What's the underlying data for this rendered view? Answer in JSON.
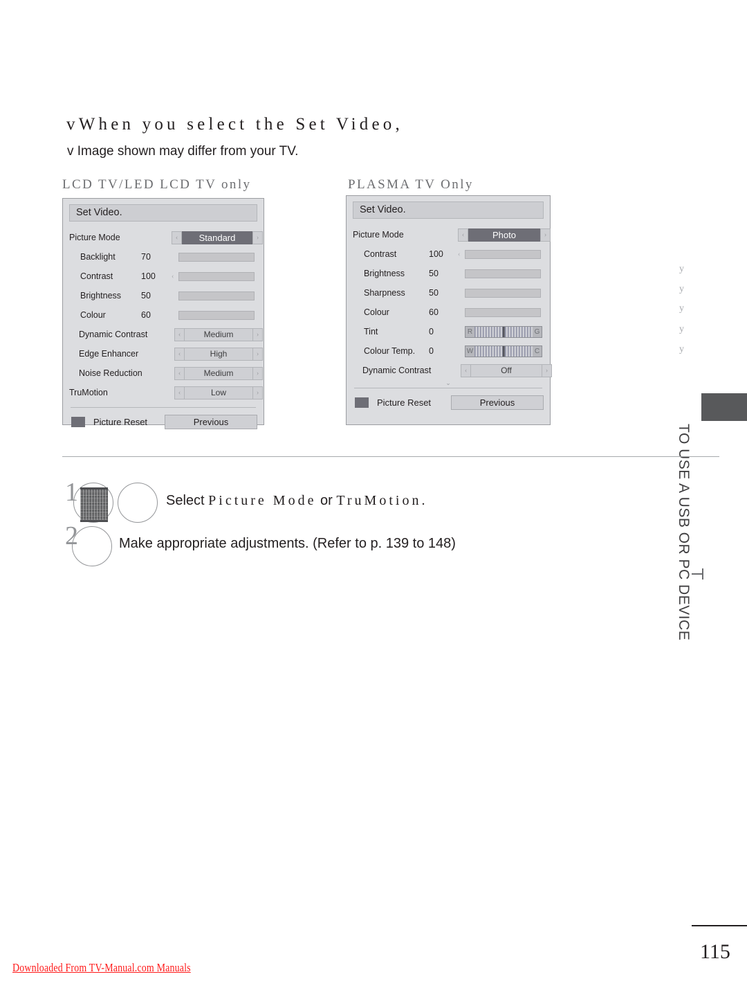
{
  "page": {
    "heading": "vWhen you select the Set Video,",
    "sub_note": "v Image shown may differ from your TV.",
    "page_number": "115",
    "download_link": "Downloaded From TV-Manual.com Manuals",
    "side_tab_text": "TO USE A USB OR PC DEVICE",
    "ghost_marks": [
      "y",
      "y",
      "y",
      "y",
      "y"
    ]
  },
  "captions": {
    "lcd": "LCD TV/LED LCD TV only",
    "plasma": "PLASMA TV Only"
  },
  "colors": {
    "osd_background": "#dcdde0",
    "osd_title_bar": "#cdced2",
    "slider_fill": "#6a6a72",
    "slider_track": "#c5c5c8",
    "highlight": "#6e6e76",
    "side_tab_block": "#58595b",
    "link_red": "#ff1a1a"
  },
  "lcd_panel": {
    "title": "Set Video.",
    "picture_mode": {
      "label": "Picture Mode",
      "value": "Standard",
      "left_arrow": "‹",
      "right_arrow": "›"
    },
    "sliders": [
      {
        "label": "Backlight",
        "value": "70",
        "percent": 70,
        "prefix": ""
      },
      {
        "label": "Contrast",
        "value": "100",
        "percent": 100,
        "prefix": "‹"
      },
      {
        "label": "Brightness",
        "value": "50",
        "percent": 50,
        "prefix": ""
      },
      {
        "label": "Colour",
        "value": "60",
        "percent": 60,
        "prefix": ""
      }
    ],
    "options": [
      {
        "label": "Dynamic Contrast",
        "value": "Medium"
      },
      {
        "label": "Edge Enhancer",
        "value": "High"
      },
      {
        "label": "Noise Reduction",
        "value": "Medium"
      },
      {
        "label": "TruMotion",
        "value": "Low"
      }
    ],
    "reset_label": "Picture Reset",
    "previous_label": "Previous"
  },
  "plasma_panel": {
    "title": "Set Video.",
    "picture_mode": {
      "label": "Picture Mode",
      "value": "Photo",
      "left_arrow": "‹",
      "right_arrow": "›"
    },
    "sliders": [
      {
        "label": "Contrast",
        "value": "100",
        "percent": 100,
        "prefix": "‹"
      },
      {
        "label": "Brightness",
        "value": "50",
        "percent": 50,
        "prefix": ""
      },
      {
        "label": "Sharpness",
        "value": "50",
        "percent": 50,
        "prefix": ""
      },
      {
        "label": "Colour",
        "value": "60",
        "percent": 60,
        "prefix": ""
      }
    ],
    "bipolar": [
      {
        "label": "Tint",
        "value": "0",
        "left_cap": "R",
        "right_cap": "G"
      },
      {
        "label": "Colour Temp.",
        "value": "0",
        "left_cap": "W",
        "right_cap": "C"
      }
    ],
    "options": [
      {
        "label": "Dynamic Contrast",
        "value": "Off"
      }
    ],
    "scroll_indicator": "⌄",
    "reset_label": "Picture Reset",
    "previous_label": "Previous"
  },
  "steps": [
    {
      "number": "1",
      "text_prefix": "Select ",
      "text_spaced": "Picture Mode",
      "text_middle": " or ",
      "text_spaced2": "TruMotion",
      "text_suffix": "."
    },
    {
      "number": "2",
      "text": "Make appropriate adjustments. (Refer to p. 139 to 148)"
    }
  ]
}
